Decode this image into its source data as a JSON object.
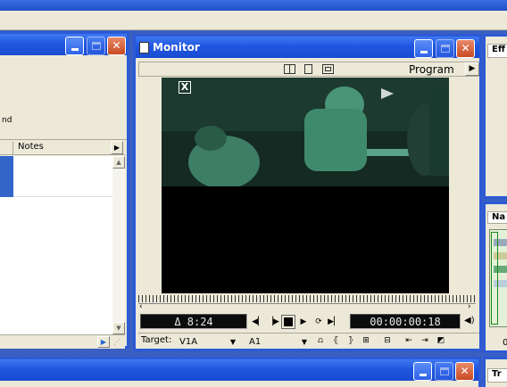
{
  "left_panel": {
    "partial_text": "nd",
    "column_header": "Notes"
  },
  "monitor": {
    "title": "Monitor",
    "view_label": "Program",
    "overlay_close": "X",
    "duration": "Δ 8:24",
    "timecode": "00:00:00:18",
    "target_label": "Target:",
    "target_video": "V1A",
    "target_audio": "A1"
  },
  "right_panel": {
    "effects_label": "Eff",
    "navigator_label": "Na",
    "zoom_label": "0",
    "bottom_label": "Tr"
  },
  "colors": {
    "accent": "#2c5ad6",
    "face": "#ece9d8",
    "lcd": "#0c0c0c",
    "video_tint": "#3a7a62"
  }
}
